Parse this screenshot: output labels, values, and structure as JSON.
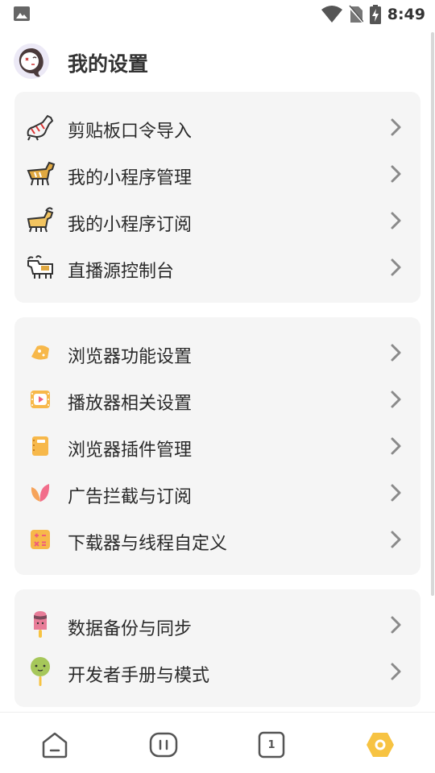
{
  "status_bar": {
    "time": "8:49"
  },
  "header": {
    "title": "我的设置"
  },
  "sections": [
    {
      "items": [
        {
          "label": "剪贴板口令导入",
          "icon": "clipboard-horse-icon"
        },
        {
          "label": "我的小程序管理",
          "icon": "horse-icon"
        },
        {
          "label": "我的小程序订阅",
          "icon": "goat-icon"
        },
        {
          "label": "直播源控制台",
          "icon": "ox-icon"
        }
      ]
    },
    {
      "items": [
        {
          "label": "浏览器功能设置",
          "icon": "cheese-icon"
        },
        {
          "label": "播放器相关设置",
          "icon": "video-icon"
        },
        {
          "label": "浏览器插件管理",
          "icon": "notebook-icon"
        },
        {
          "label": "广告拦截与订阅",
          "icon": "leaf-icon"
        },
        {
          "label": "下载器与线程自定义",
          "icon": "calculator-icon"
        }
      ]
    },
    {
      "items": [
        {
          "label": "数据备份与同步",
          "icon": "popsicle-icon"
        },
        {
          "label": "开发者手册与模式",
          "icon": "lollipop-icon"
        }
      ]
    }
  ],
  "bottom_nav": {
    "tab_count": "1"
  },
  "colors": {
    "accent": "#f7c342",
    "card_bg": "#f5f5f5",
    "chevron": "#8a8a8a"
  }
}
